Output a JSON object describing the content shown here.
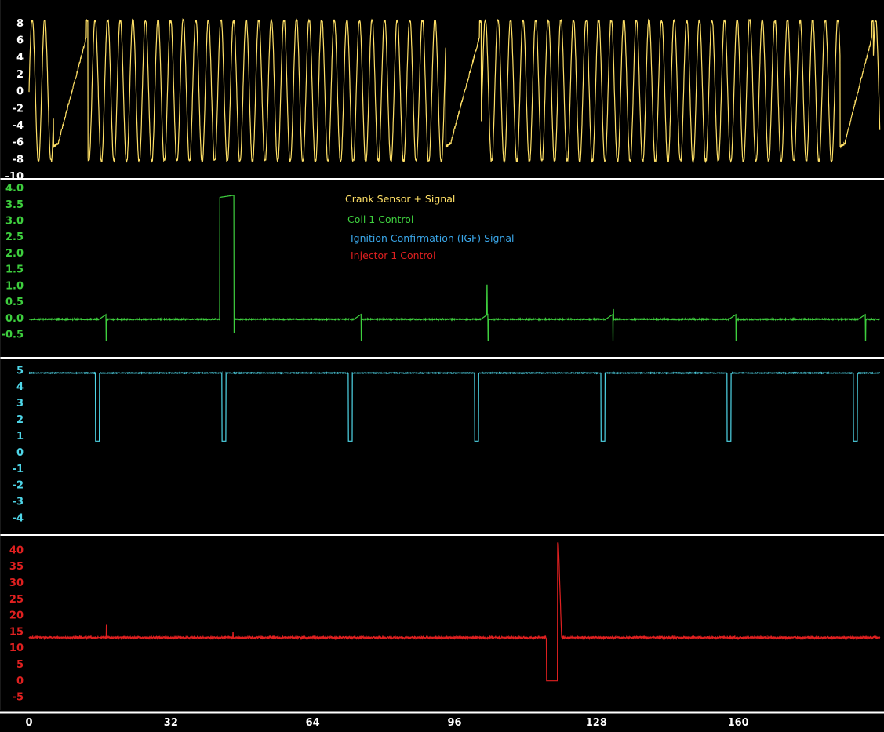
{
  "chart_data": {
    "type": "line",
    "title": "",
    "x": {
      "label": "",
      "range": [
        0,
        192
      ],
      "ticks": [
        "0",
        "32",
        "64",
        "96",
        "128",
        "160"
      ]
    },
    "legend": {
      "placement": "top-center",
      "entries": [
        {
          "label": "Crank Sensor + Signal",
          "color": "#ffe066"
        },
        {
          "label": "Coil 1 Control",
          "color": "#3ecf3e"
        },
        {
          "label": "Ignition Confirmation (IGF) Signal",
          "color": "#3aa6e8"
        },
        {
          "label": "Injector 1 Control",
          "color": "#e02020"
        }
      ]
    },
    "grid": false,
    "panels": [
      {
        "id": "crank",
        "color": "#ffe066",
        "tick_color": "#ffffff",
        "ylim": [
          -10,
          9
        ],
        "ticks": [
          "8",
          "6",
          "4",
          "2",
          "0",
          "-2",
          "-4",
          "-6",
          "-8",
          "-10"
        ],
        "amplitude": 8.2,
        "tooth_period": 2.84,
        "gaps": [
          [
            5.5,
            13.3
          ],
          [
            94.0,
            102.0
          ],
          [
            183.0,
            190.5
          ]
        ]
      },
      {
        "id": "coil",
        "color": "#3ecf3e",
        "tick_color": "#3ecf3e",
        "ylim": [
          -0.8,
          4.05
        ],
        "ticks": [
          "4.0",
          "3.5",
          "3.0",
          "2.5",
          "2.0",
          "1.5",
          "1.0",
          "0.5",
          "0.0",
          "-0.5"
        ],
        "baseline": -0.05,
        "dwell_high": 3.7,
        "dwell": [
          43.0,
          46.2
        ],
        "ramp_ends": [
          17.4,
          74.9,
          103.5,
          131.7,
          159.5,
          188.7
        ],
        "spikes": [
          [
            103.3,
            1.0
          ],
          [
            131.8,
            0.25
          ]
        ]
      },
      {
        "id": "igf",
        "color": "#4fd6e8",
        "tick_color": "#4fd6e8",
        "ylim": [
          -4.5,
          5.3
        ],
        "ticks": [
          "5",
          "4",
          "3",
          "2",
          "1",
          "0",
          "-1",
          "-2",
          "-3",
          "-4"
        ],
        "high": 4.8,
        "low": 0.65,
        "pulses": [
          [
            15.0,
            15.9
          ],
          [
            43.5,
            44.4
          ],
          [
            72.0,
            72.9
          ],
          [
            100.5,
            101.4
          ],
          [
            129.0,
            129.9
          ],
          [
            157.5,
            158.4
          ],
          [
            186.0,
            186.9
          ]
        ]
      },
      {
        "id": "injector",
        "color": "#e02020",
        "tick_color": "#e02020",
        "ylim": [
          -7,
          42
        ],
        "ticks": [
          "40",
          "35",
          "30",
          "25",
          "20",
          "15",
          "10",
          "5",
          "0",
          "-5"
        ],
        "baseline": 13.0,
        "on_window": [
          116.7,
          119.2
        ],
        "on_level": -0.2,
        "flyback_peak": 42.0,
        "spikes": [
          [
            17.5,
            17.0
          ],
          [
            46.0,
            14.5
          ]
        ]
      }
    ]
  }
}
